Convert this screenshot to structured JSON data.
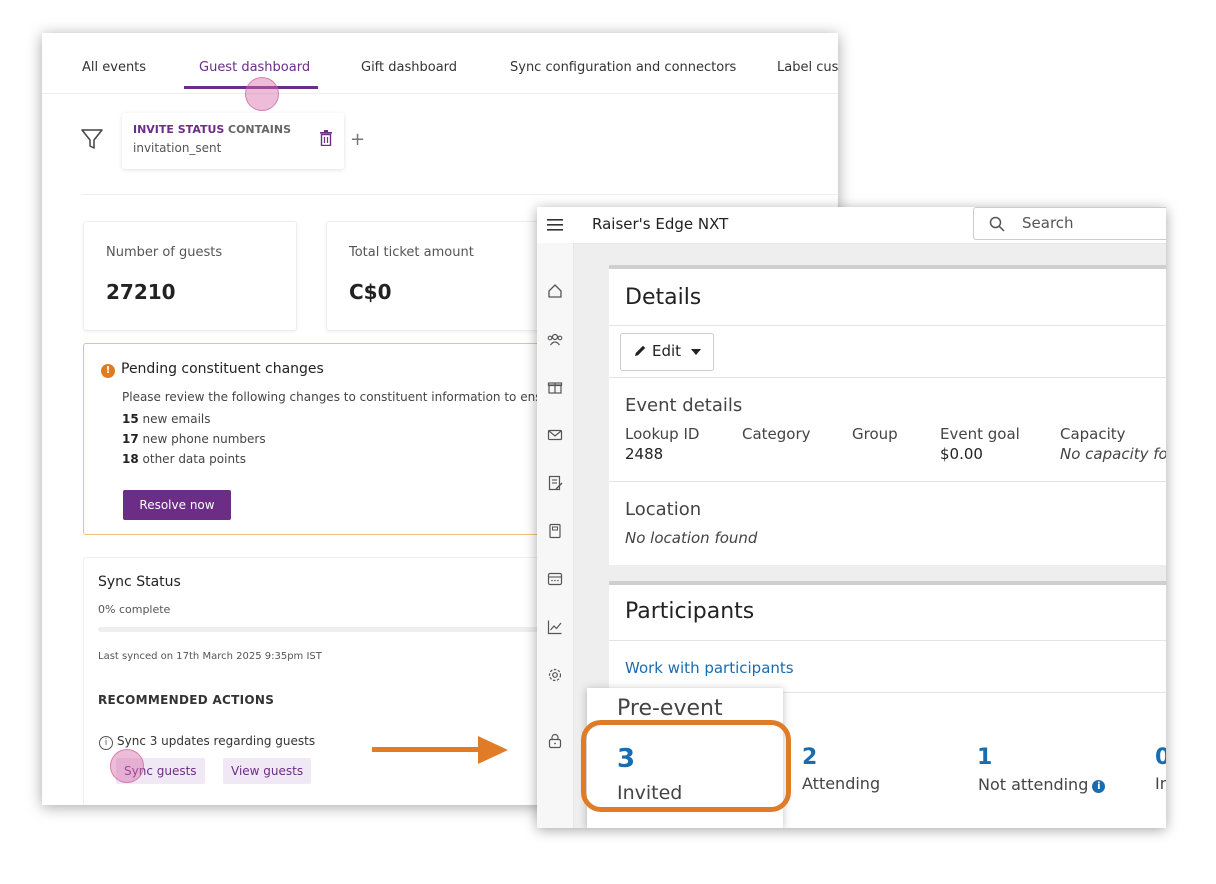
{
  "guest_app": {
    "tabs": [
      "All events",
      "Guest dashboard",
      "Gift dashboard",
      "Sync configuration and connectors",
      "Label cust"
    ],
    "active_tab": "Guest dashboard",
    "filter": {
      "field": "INVITE STATUS",
      "operator": "CONTAINS",
      "value": "invitation_sent",
      "add_symbol": "+"
    },
    "stats": [
      {
        "label": "Number of guests",
        "value": "27210"
      },
      {
        "label": "Total ticket amount",
        "value": "C$0"
      }
    ],
    "pending": {
      "title": "Pending constituent changes",
      "text": "Please review the following changes to constituent information to ens",
      "items": [
        {
          "count": "15",
          "label": "new emails"
        },
        {
          "count": "17",
          "label": "new phone numbers"
        },
        {
          "count": "18",
          "label": "other data points"
        }
      ],
      "button": "Resolve now"
    },
    "sync": {
      "title": "Sync Status",
      "percent_text": "0% complete",
      "progress": 0,
      "last_synced": "Last synced on 17th March 2025 9:35pm IST",
      "recommended_heading": "RECOMMENDED ACTIONS",
      "update_text": "Sync 3 updates regarding guests",
      "buttons": [
        "Sync guests",
        "View guests"
      ]
    }
  },
  "rexnxt": {
    "title": "Raiser's Edge NXT",
    "search_placeholder": "Search",
    "nav_icons": [
      "home-icon",
      "constituents-icon",
      "gift-icon",
      "mail-icon",
      "notes-icon",
      "book-icon",
      "calendar-icon",
      "analytics-icon",
      "settings-icon",
      "lock-icon"
    ],
    "details": {
      "title": "Details",
      "edit_label": "Edit",
      "event_details_heading": "Event details",
      "fields": [
        {
          "label": "Lookup ID",
          "value": "2488"
        },
        {
          "label": "Category",
          "value": ""
        },
        {
          "label": "Group",
          "value": ""
        },
        {
          "label": "Event goal",
          "value": "$0.00"
        },
        {
          "label": "Capacity",
          "value": "No capacity fou"
        }
      ],
      "location_heading": "Location",
      "location_value": "No location found"
    },
    "participants": {
      "title": "Participants",
      "link": "Work with participants",
      "pre_event_heading": "Pre-event",
      "counts": [
        {
          "value": "3",
          "label": "Invited"
        },
        {
          "value": "2",
          "label": "Attending"
        },
        {
          "value": "1",
          "label": "Not attending"
        },
        {
          "value": "0",
          "label": "In"
        }
      ]
    }
  },
  "colors": {
    "accent_purple": "#6b2d86",
    "highlight_orange": "#e07b27",
    "link_blue": "#1a6cb0"
  }
}
